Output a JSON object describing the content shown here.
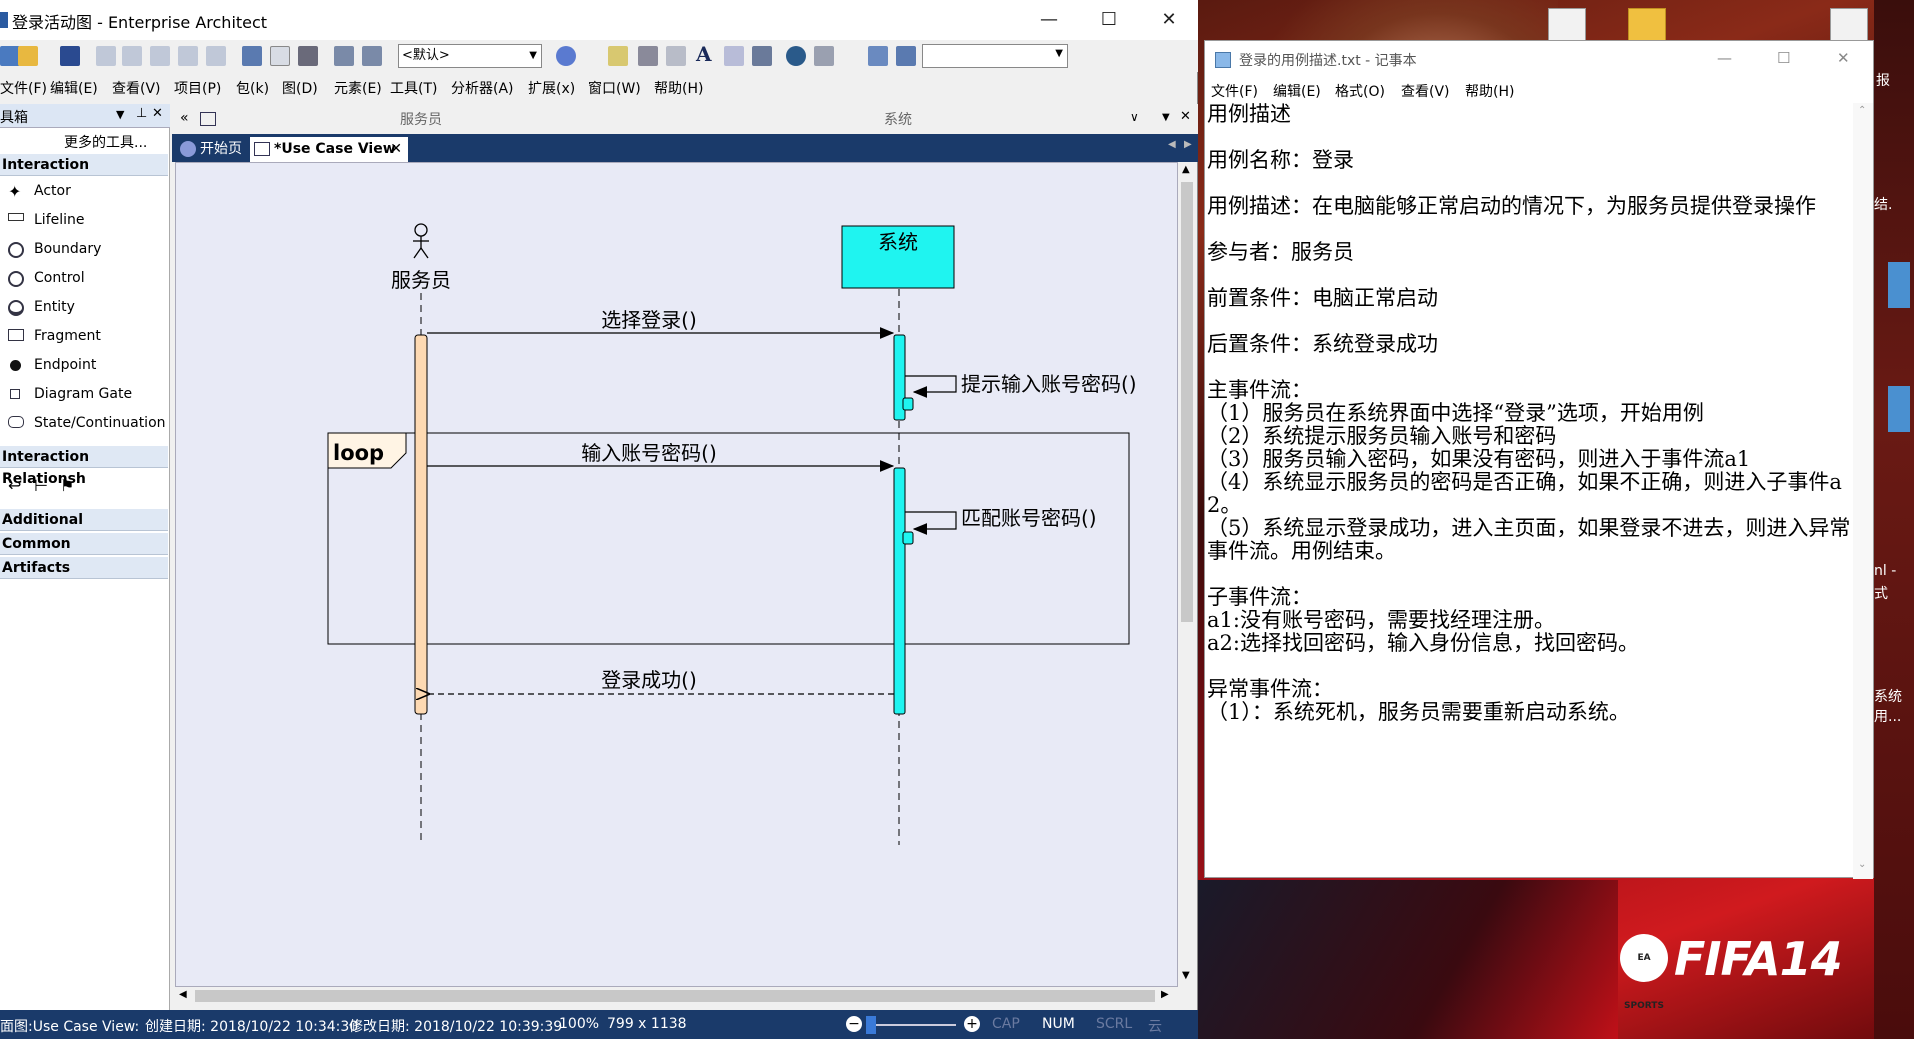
{
  "ea": {
    "title": "登录活动图 - Enterprise Architect",
    "toolbar": {
      "style_select": "<默认>"
    },
    "menu": [
      "文件(F)",
      "编辑(E)",
      "查看(V)",
      "项目(P)",
      "包(k)",
      "图(D)",
      "元素(E)",
      "工具(T)",
      "分析器(A)",
      "扩展(x)",
      "窗口(W)",
      "帮助(H)"
    ],
    "toolbox": {
      "header": "具箱",
      "more_tools": "更多的工具...",
      "sections": [
        "Interaction",
        "Interaction Relationsh",
        "Additional",
        "Common",
        "Artifacts"
      ],
      "items": [
        "Actor",
        "Lifeline",
        "Boundary",
        "Control",
        "Entity",
        "Fragment",
        "Endpoint",
        "Diagram Gate",
        "State/Continuation"
      ]
    },
    "doc_header": {
      "col1": "服务员",
      "col2": "系统"
    },
    "tabs": [
      "开始页",
      "*Use Case View"
    ],
    "diagram": {
      "actor": "服务员",
      "system": "系统",
      "messages": [
        "选择登录()",
        "提示输入账号密码()",
        "输入账号密码()",
        "匹配账号密码()",
        "登录成功()"
      ],
      "fragment": "loop"
    },
    "status": {
      "diagram": "面图:Use Case View:",
      "created": "创建日期: 2018/10/22 10:34:30",
      "modified": "修改日期: 2018/10/22 10:39:39",
      "zoom": "100%",
      "size": "799 x 1138",
      "cap": "CAP",
      "num": "NUM",
      "scrl": "SCRL",
      "cloud": "云"
    }
  },
  "notepad": {
    "title": "登录的用例描述.txt - 记事本",
    "menu": [
      "文件(F)",
      "编辑(E)",
      "格式(O)",
      "查看(V)",
      "帮助(H)"
    ],
    "lines": [
      "用例描述",
      "",
      "用例名称：登录",
      "",
      "用例描述：在电脑能够正常启动的情况下，为服务员提供登录操作",
      "",
      "参与者：服务员",
      "",
      "前置条件：电脑正常启动",
      "",
      "后置条件：系统登录成功",
      "",
      "主事件流：",
      "（1）服务员在系统界面中选择“登录”选项，开始用例",
      "（2）系统提示服务员输入账号和密码",
      "（3）服务员输入密码，如果没有密码，则进入于事件流a1",
      "（4）系统显示服务员的密码是否正确，如果不正确，则进入子事件a2。",
      "（5）系统显示登录成功，进入主页面，如果登录不进去，则进入异常事件流。用例结束。",
      "",
      "子事件流：",
      "a1:没有账号密码，需要找经理注册。",
      "a2:选择找回密码，输入身份信息，找回密码。",
      "",
      "异常事件流：",
      "（1）：系统死机，服务员需要重新启动系统。"
    ]
  },
  "desktop": {
    "right_texts": [
      "报",
      "结.",
      "nl -",
      "式",
      "系统",
      "用..."
    ],
    "fifa": "FIFA14",
    "ea_sports": "EA SPORTS"
  }
}
